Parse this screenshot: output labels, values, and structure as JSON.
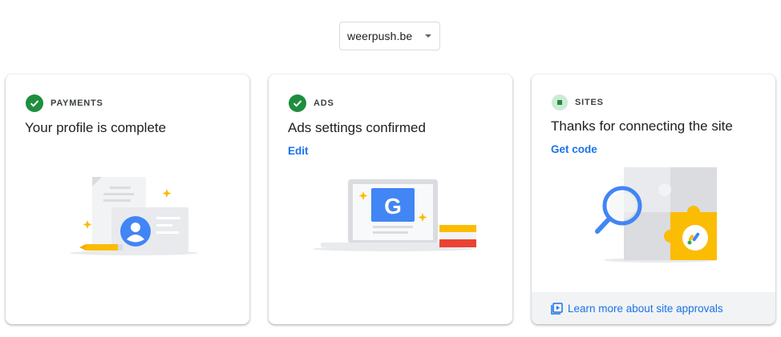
{
  "site_selector": {
    "value": "weerpush.be"
  },
  "cards": [
    {
      "label": "PAYMENTS",
      "title": "Your profile is complete",
      "status_icon": "check-circle-icon",
      "illustration": "profile-card-illustration"
    },
    {
      "label": "ADS",
      "title": "Ads settings confirmed",
      "link": "Edit",
      "status_icon": "check-circle-icon",
      "illustration": "laptop-google-illustration"
    },
    {
      "label": "SITES",
      "title": "Thanks for connecting the site",
      "link": "Get code",
      "status_icon": "pending-square-icon",
      "illustration": "puzzle-search-illustration",
      "footer": {
        "link": "Learn more about site approvals",
        "icon": "video-library-icon"
      }
    }
  ],
  "colors": {
    "accent_blue": "#1a73e8",
    "success_green": "#1e8e3e",
    "google_blue": "#4285f4",
    "yellow": "#fbbc04",
    "red": "#ea4335"
  }
}
